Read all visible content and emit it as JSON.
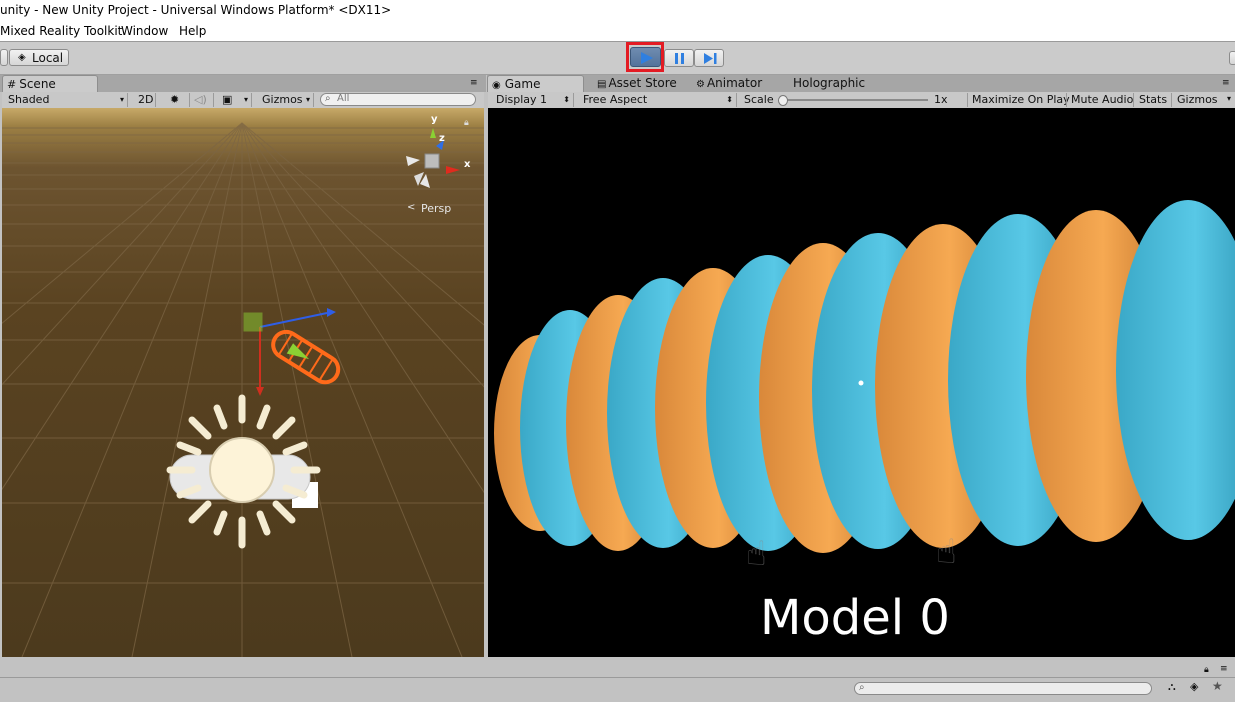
{
  "window": {
    "title": "unity - New Unity Project - Universal Windows Platform* <DX11>"
  },
  "menu": [
    "Mixed Reality Toolkit",
    "Window",
    "Help"
  ],
  "toolbar": {
    "pivot_label": "Local",
    "play_highlight_color": "#e31b23"
  },
  "scene": {
    "tab_label": "Scene",
    "shading": "Shaded",
    "mode_2d": "2D",
    "gizmos_label": "Gizmos",
    "search_placeholder": "All",
    "gizmo_axes": {
      "y": "y",
      "x": "x",
      "z": "z"
    },
    "persp_label": "Persp"
  },
  "tabs": {
    "game": "Game",
    "asset_store": "Asset Store",
    "animator": "Animator",
    "holographic": "Holographic"
  },
  "game": {
    "display": "Display 1",
    "aspect": "Free Aspect",
    "scale_label": "Scale",
    "scale_value": "1x",
    "maximize": "Maximize On Play",
    "mute": "Mute Audio",
    "stats": "Stats",
    "gizmos": "Gizmos",
    "model_label": "Model 0",
    "colors": {
      "blue": "#56c3e0",
      "orange": "#f2a24b"
    }
  },
  "icons": [
    "play-icon",
    "pause-icon",
    "step-icon",
    "sun-icon",
    "audio-icon",
    "image-icon",
    "search-icon",
    "lock-icon",
    "menu-icon",
    "hand-icon",
    "gizmo-axis-icon"
  ]
}
